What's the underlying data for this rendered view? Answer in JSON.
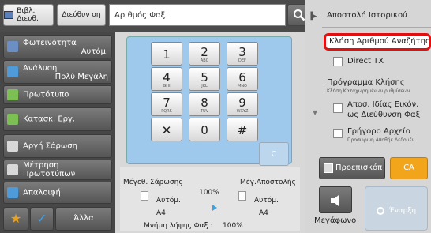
{
  "topbar": {
    "address_book": "Βιβλ. Διευθ.",
    "address_entry": "Διεύθυν ση",
    "fax_number_placeholder": "Αριθμός Φαξ"
  },
  "sidebar": {
    "brightness": {
      "label": "Φωτεινότητα",
      "value": "Αυτόμ."
    },
    "resolution": {
      "label": "Ανάλυση",
      "value": "Πολύ Μεγάλη"
    },
    "original": {
      "label": "Πρωτότυπο"
    },
    "program": {
      "label": "Κατασκ. Εργ."
    },
    "slow_scan": {
      "label": "Αργή Σάρωση"
    },
    "original_count": {
      "label": "Μέτρηση Πρωτοτύπων"
    },
    "erase": {
      "label": "Απαλοιφή"
    },
    "star": "★",
    "check": "✓",
    "other": "Άλλα"
  },
  "keypad": {
    "keys": [
      {
        "d": "1",
        "s": ""
      },
      {
        "d": "2",
        "s": "ABC"
      },
      {
        "d": "3",
        "s": "DEF"
      },
      {
        "d": "4",
        "s": "GHI"
      },
      {
        "d": "5",
        "s": "JKL"
      },
      {
        "d": "6",
        "s": "MNO"
      },
      {
        "d": "7",
        "s": "PQRS"
      },
      {
        "d": "8",
        "s": "TUV"
      },
      {
        "d": "9",
        "s": "WXYZ"
      },
      {
        "d": "✕",
        "s": ""
      },
      {
        "d": "0",
        "s": ""
      },
      {
        "d": "#",
        "s": ""
      }
    ],
    "clear": "C"
  },
  "info": {
    "scan_size_label": "Μέγεθ. Σάρωσης",
    "send_size_label": "Μέγ.Αποστολής",
    "ratio": "100%",
    "auto_left": "Αυτόμ.",
    "auto_right": "Αυτόμ.",
    "size_left": "A4",
    "size_right": "A4",
    "memory_label": "Μνήμη λήψης Φαξ :",
    "memory_value": "100%"
  },
  "right": {
    "send_history": "Αποστολή Ιστορικού",
    "recall_search": "Κλήση Αριθμού Αναζήτησης",
    "direct_tx": "Direct TX",
    "call_program": "Πρόγραμμα Κλήσης",
    "call_program_sub": "Κλήση Καταχωρημένων ρυθμίσεων",
    "send_same_image_1": "Αποσ. Ιδίας Εικόν.",
    "send_same_image_2": "ως Διεύθυνση Φαξ",
    "quick_file": "Γρήγορο Αρχείο",
    "quick_file_sub": "Προσωρινή Αποθήκ.Δεδομέν",
    "preview": "Προεπισκόπ",
    "ca": "CA",
    "speaker": "Μεγάφωνο",
    "start": "Έναρξη"
  }
}
